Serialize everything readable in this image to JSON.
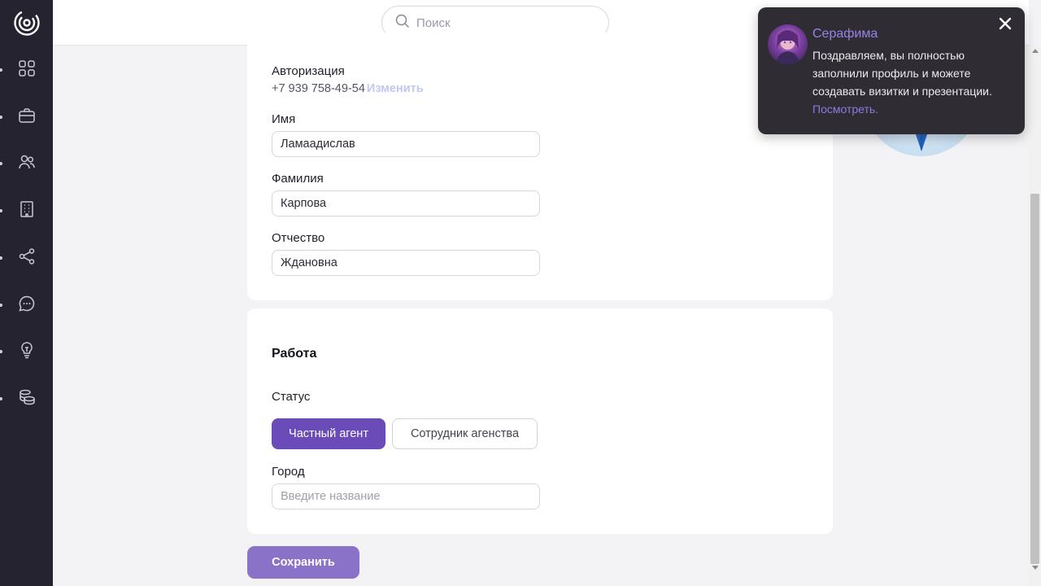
{
  "search": {
    "placeholder": "Поиск"
  },
  "sidebar": {
    "items": [
      {
        "icon": "grid-icon"
      },
      {
        "icon": "briefcase-icon"
      },
      {
        "icon": "users-icon"
      },
      {
        "icon": "building-icon"
      },
      {
        "icon": "share-icon"
      },
      {
        "icon": "chat-icon"
      },
      {
        "icon": "lightbulb-icon"
      },
      {
        "icon": "database-icon"
      }
    ]
  },
  "profile": {
    "auth_label": "Авторизация",
    "phone": "+7 939 758-49-54",
    "change_link": "Изменить",
    "first_name_label": "Имя",
    "first_name_value": "Ламаадислав",
    "last_name_label": "Фамилия",
    "last_name_value": "Карпова",
    "patronymic_label": "Отчество",
    "patronymic_value": "Ждановна"
  },
  "work": {
    "title": "Работа",
    "status_label": "Статус",
    "status_options": [
      "Частный агент",
      "Сотрудник агенства"
    ],
    "selected_status": "Частный агент",
    "city_label": "Город",
    "city_placeholder": "Введите название"
  },
  "save_button": "Сохранить",
  "toast": {
    "name": "Серафима",
    "message": "Поздравляем, вы полностью заполнили профиль и можете создавать визитки и презентации.",
    "link": "Посмотреть."
  },
  "colors": {
    "sidebar_bg": "#25232f",
    "accent": "#6a4bb8",
    "save_button": "#8a72c9",
    "toast_bg": "#2f2d33",
    "toast_name": "#9a82e6"
  }
}
